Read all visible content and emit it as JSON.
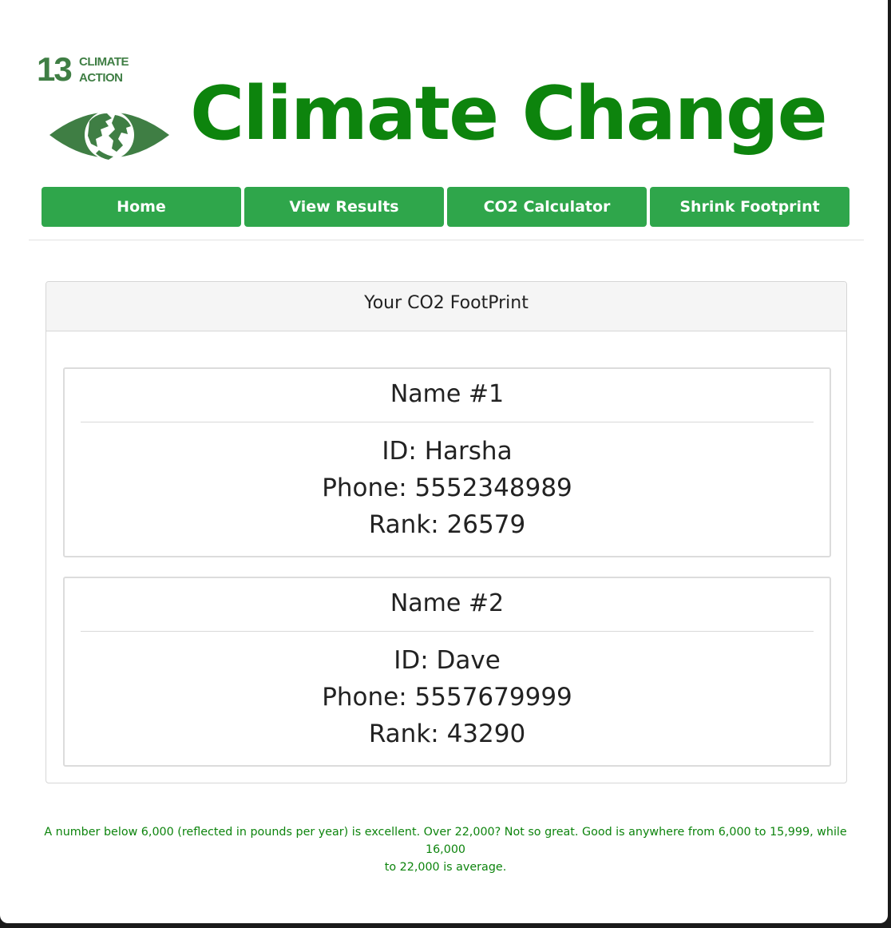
{
  "header": {
    "logo": {
      "number": "13",
      "line1": "CLIMATE",
      "line2": "ACTION",
      "icon": "globe-eye-icon",
      "color": "#3f7e44"
    },
    "title": "Climate Change",
    "title_color": "#0d840d"
  },
  "nav": {
    "color": "#2fa64b",
    "items": [
      {
        "label": "Home"
      },
      {
        "label": "View Results"
      },
      {
        "label": "CO2 Calculator"
      },
      {
        "label": "Shrink Footprint"
      }
    ]
  },
  "panel": {
    "heading": "Your CO2 FootPrint",
    "cards": [
      {
        "title": "Name #1",
        "id_line": "ID: Harsha",
        "phone_line": "Phone: 5552348989",
        "rank_line": "Rank: 26579"
      },
      {
        "title": "Name #2",
        "id_line": "ID: Dave",
        "phone_line": "Phone: 5557679999",
        "rank_line": "Rank: 43290"
      }
    ]
  },
  "footnote": {
    "line1": "A number below 6,000 (reflected in pounds per year) is excellent. Over 22,000? Not so great. Good is anywhere from 6,000 to 15,999, while 16,000",
    "line2": "to 22,000 is average."
  }
}
